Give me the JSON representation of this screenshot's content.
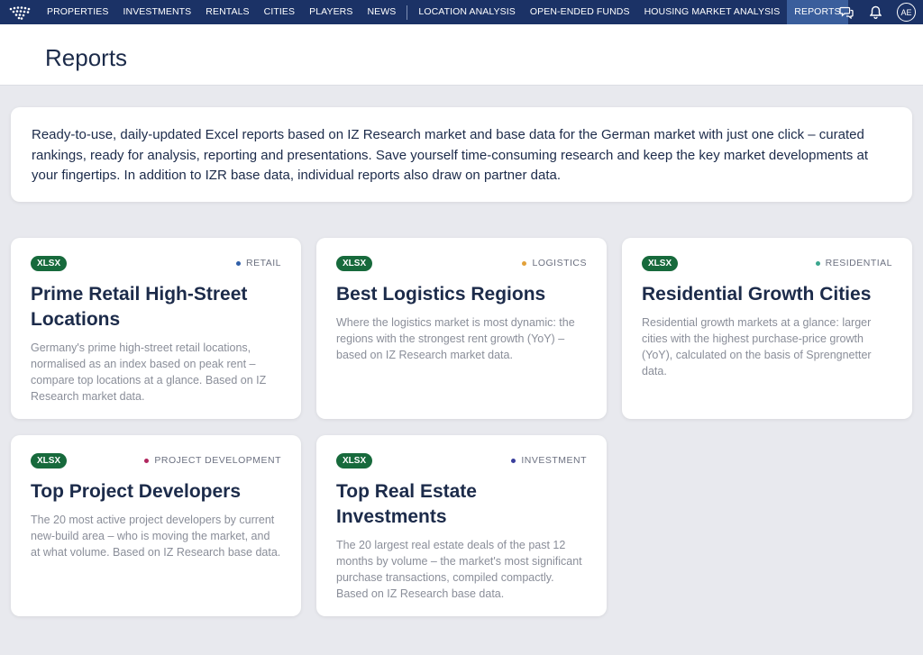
{
  "nav": {
    "items": [
      {
        "label": "PROPERTIES"
      },
      {
        "label": "INVESTMENTS"
      },
      {
        "label": "RENTALS"
      },
      {
        "label": "CITIES"
      },
      {
        "label": "PLAYERS"
      },
      {
        "label": "NEWS"
      },
      {
        "label": "LOCATION ANALYSIS"
      },
      {
        "label": "OPEN-ENDED FUNDS"
      },
      {
        "label": "HOUSING MARKET ANALYSIS"
      },
      {
        "label": "REPORTS"
      }
    ],
    "active": "REPORTS",
    "avatar_initials": "AE",
    "icons": [
      "logo-icon",
      "chat-icon",
      "bell-icon"
    ]
  },
  "header": {
    "title": "Reports"
  },
  "intro": {
    "text": "Ready-to-use, daily-updated Excel reports based on IZ Research market and base data for the German market with just one click – curated rankings, ready for analysis, reporting and presentations. Save yourself time-consuming research and keep the key market developments at your fingertips. In addition to IZR base data, individual reports also draw on partner data."
  },
  "cards": [
    {
      "badge": "XLSX",
      "category": "RETAIL",
      "dot_color": "#2f5fa8",
      "title": "Prime Retail High-Street Locations",
      "description": "Germany's prime high-street retail locations, normalised as an index based on peak rent – compare top locations at a glance. Based on IZ Research market data."
    },
    {
      "badge": "XLSX",
      "category": "LOGISTICS",
      "dot_color": "#e2a13a",
      "title": "Best Logistics Regions",
      "description": "Where the logistics market is most dynamic: the regions with the strongest rent growth (YoY) – based on IZ Research market data."
    },
    {
      "badge": "XLSX",
      "category": "RESIDENTIAL",
      "dot_color": "#3aa68e",
      "title": "Residential Growth Cities",
      "description": "Residential growth markets at a glance: larger cities with the highest purchase-price growth (YoY), calculated on the basis of Sprengnetter data."
    },
    {
      "badge": "XLSX",
      "category": "PROJECT DEVELOPMENT",
      "dot_color": "#b0265e",
      "title": "Top Project Developers",
      "description": "The 20 most active project developers by current new-build area – who is moving the market, and at what volume. Based on IZ Research base data."
    },
    {
      "badge": "XLSX",
      "category": "INVESTMENT",
      "dot_color": "#3a3f9c",
      "title": "Top Real Estate Investments",
      "description": "The 20 largest real estate deals of the past 12 months by volume – the market's most significant purchase transactions, compiled compactly. Based on IZ Research base data."
    }
  ]
}
